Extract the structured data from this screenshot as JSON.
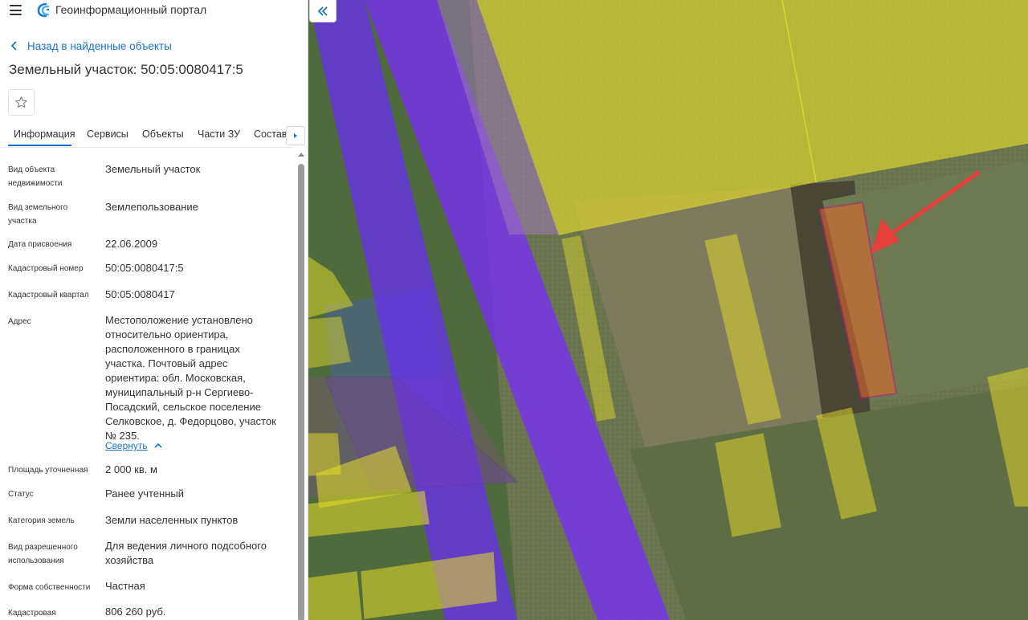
{
  "header": {
    "app_title": "Геоинформационный портал"
  },
  "nav": {
    "back_label": "Назад в найденные объекты"
  },
  "object": {
    "title": "Земельный участок: 50:05:0080417:5"
  },
  "tabs": [
    {
      "label": "Информация",
      "active": true
    },
    {
      "label": "Сервисы",
      "active": false
    },
    {
      "label": "Объекты",
      "active": false
    },
    {
      "label": "Части ЗУ",
      "active": false
    },
    {
      "label": "Состав",
      "active": false
    }
  ],
  "properties": [
    {
      "label_lines": [
        "Вид объекта",
        "недвижимости"
      ],
      "value": "Земельный участок"
    },
    {
      "label_lines": [
        "Вид земельного",
        "участка"
      ],
      "value": "Землепользование"
    },
    {
      "label_lines": [
        "Дата присвоения"
      ],
      "value": "22.06.2009"
    },
    {
      "label_lines": [
        "Кадастровый номер"
      ],
      "value": "50:05:0080417:5"
    },
    {
      "label_lines": [
        "Кадастровый квартал"
      ],
      "value": "50:05:0080417"
    },
    {
      "label_lines": [
        "Адрес"
      ],
      "value_lines": [
        "Местоположение установлено",
        "относительно ориентира,",
        "расположенного в границах",
        "участка. Почтовый адрес",
        "ориентира: обл. Московская,",
        "муниципальный р-н Сергиево-",
        "Посадский, сельское поселение",
        "Селковское, д. Федорцово, участок",
        "№ 235."
      ]
    },
    {
      "label_lines": [
        "Площадь уточненная"
      ],
      "value": "2 000 кв. м"
    },
    {
      "label_lines": [
        "Статус"
      ],
      "value": "Ранее учтенный"
    },
    {
      "label_lines": [
        "Категория земель"
      ],
      "value": "Земли населенных пунктов"
    },
    {
      "label_lines": [
        "Вид разрешенного",
        "использования"
      ],
      "value_lines": [
        "Для ведения личного подсобного",
        "хозяйства"
      ]
    },
    {
      "label_lines": [
        "Форма собственности"
      ],
      "value": "Частная"
    },
    {
      "label_lines": [
        "Кадастровая"
      ],
      "value": "806 260 руб."
    }
  ],
  "address_collapse_label": "Свернуть",
  "icons": {
    "menu": "hamburger-icon",
    "logo": "portal-logo-icon",
    "back": "chevron-left-icon",
    "favorite": "star-outline-icon",
    "tabs_next": "chevron-right-icon",
    "collapse": "chevron-up-icon",
    "panel_toggle": "double-chevron-left-icon"
  },
  "colors": {
    "accent": "#1a73c8",
    "parcel_fill": "#e6e02a",
    "highlight_parcel": "#c2187a",
    "road_band": "#7a2cff",
    "arrow": "#e8413c"
  }
}
